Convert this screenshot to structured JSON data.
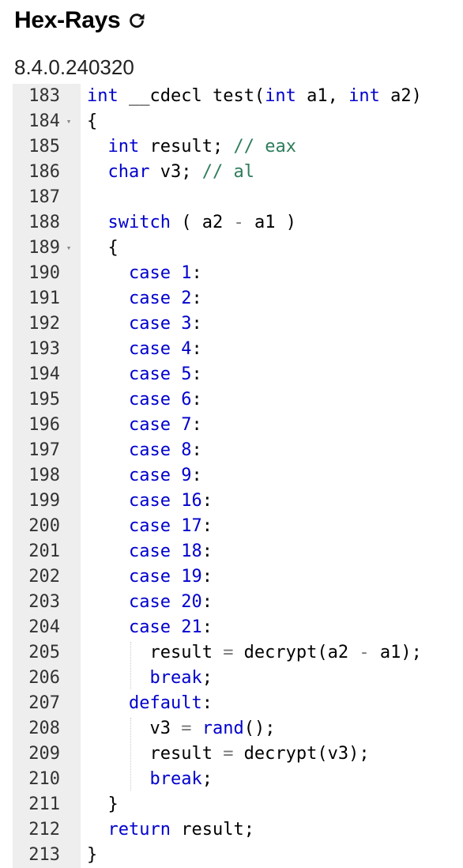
{
  "header": {
    "title": "Hex-Rays",
    "refresh_icon": "refresh-icon",
    "version": "8.4.0.240320"
  },
  "code": {
    "lines": [
      {
        "n": "183",
        "fold": false,
        "tokens": [
          {
            "t": "",
            "c": ""
          },
          {
            "t": "int",
            "c": "kw"
          },
          {
            "t": " __cdecl test(",
            "c": ""
          },
          {
            "t": "int",
            "c": "kw"
          },
          {
            "t": " a1, ",
            "c": ""
          },
          {
            "t": "int",
            "c": "kw"
          },
          {
            "t": " a2)",
            "c": ""
          }
        ]
      },
      {
        "n": "184",
        "fold": true,
        "tokens": [
          {
            "t": "{",
            "c": ""
          }
        ]
      },
      {
        "n": "185",
        "fold": false,
        "tokens": [
          {
            "t": "  ",
            "c": ""
          },
          {
            "t": "int",
            "c": "kw"
          },
          {
            "t": " result; ",
            "c": ""
          },
          {
            "t": "// eax",
            "c": "cm"
          }
        ]
      },
      {
        "n": "186",
        "fold": false,
        "tokens": [
          {
            "t": "  ",
            "c": ""
          },
          {
            "t": "char",
            "c": "kw"
          },
          {
            "t": " v3; ",
            "c": ""
          },
          {
            "t": "// al",
            "c": "cm"
          }
        ]
      },
      {
        "n": "187",
        "fold": false,
        "tokens": []
      },
      {
        "n": "188",
        "fold": false,
        "tokens": [
          {
            "t": "  ",
            "c": ""
          },
          {
            "t": "switch",
            "c": "kw"
          },
          {
            "t": " ( a2 ",
            "c": ""
          },
          {
            "t": "-",
            "c": "op"
          },
          {
            "t": " a1 )",
            "c": ""
          }
        ]
      },
      {
        "n": "189",
        "fold": true,
        "tokens": [
          {
            "t": "  {",
            "c": ""
          }
        ]
      },
      {
        "n": "190",
        "fold": false,
        "tokens": [
          {
            "t": "    ",
            "c": ""
          },
          {
            "t": "case",
            "c": "kw"
          },
          {
            "t": " ",
            "c": ""
          },
          {
            "t": "1",
            "c": "kw"
          },
          {
            "t": ":",
            "c": ""
          }
        ]
      },
      {
        "n": "191",
        "fold": false,
        "tokens": [
          {
            "t": "    ",
            "c": ""
          },
          {
            "t": "case",
            "c": "kw"
          },
          {
            "t": " ",
            "c": ""
          },
          {
            "t": "2",
            "c": "kw"
          },
          {
            "t": ":",
            "c": ""
          }
        ]
      },
      {
        "n": "192",
        "fold": false,
        "tokens": [
          {
            "t": "    ",
            "c": ""
          },
          {
            "t": "case",
            "c": "kw"
          },
          {
            "t": " ",
            "c": ""
          },
          {
            "t": "3",
            "c": "kw"
          },
          {
            "t": ":",
            "c": ""
          }
        ]
      },
      {
        "n": "193",
        "fold": false,
        "tokens": [
          {
            "t": "    ",
            "c": ""
          },
          {
            "t": "case",
            "c": "kw"
          },
          {
            "t": " ",
            "c": ""
          },
          {
            "t": "4",
            "c": "kw"
          },
          {
            "t": ":",
            "c": ""
          }
        ]
      },
      {
        "n": "194",
        "fold": false,
        "tokens": [
          {
            "t": "    ",
            "c": ""
          },
          {
            "t": "case",
            "c": "kw"
          },
          {
            "t": " ",
            "c": ""
          },
          {
            "t": "5",
            "c": "kw"
          },
          {
            "t": ":",
            "c": ""
          }
        ]
      },
      {
        "n": "195",
        "fold": false,
        "tokens": [
          {
            "t": "    ",
            "c": ""
          },
          {
            "t": "case",
            "c": "kw"
          },
          {
            "t": " ",
            "c": ""
          },
          {
            "t": "6",
            "c": "kw"
          },
          {
            "t": ":",
            "c": ""
          }
        ]
      },
      {
        "n": "196",
        "fold": false,
        "tokens": [
          {
            "t": "    ",
            "c": ""
          },
          {
            "t": "case",
            "c": "kw"
          },
          {
            "t": " ",
            "c": ""
          },
          {
            "t": "7",
            "c": "kw"
          },
          {
            "t": ":",
            "c": ""
          }
        ]
      },
      {
        "n": "197",
        "fold": false,
        "tokens": [
          {
            "t": "    ",
            "c": ""
          },
          {
            "t": "case",
            "c": "kw"
          },
          {
            "t": " ",
            "c": ""
          },
          {
            "t": "8",
            "c": "kw"
          },
          {
            "t": ":",
            "c": ""
          }
        ]
      },
      {
        "n": "198",
        "fold": false,
        "tokens": [
          {
            "t": "    ",
            "c": ""
          },
          {
            "t": "case",
            "c": "kw"
          },
          {
            "t": " ",
            "c": ""
          },
          {
            "t": "9",
            "c": "kw"
          },
          {
            "t": ":",
            "c": ""
          }
        ]
      },
      {
        "n": "199",
        "fold": false,
        "tokens": [
          {
            "t": "    ",
            "c": ""
          },
          {
            "t": "case",
            "c": "kw"
          },
          {
            "t": " ",
            "c": ""
          },
          {
            "t": "16",
            "c": "kw"
          },
          {
            "t": ":",
            "c": ""
          }
        ]
      },
      {
        "n": "200",
        "fold": false,
        "tokens": [
          {
            "t": "    ",
            "c": ""
          },
          {
            "t": "case",
            "c": "kw"
          },
          {
            "t": " ",
            "c": ""
          },
          {
            "t": "17",
            "c": "kw"
          },
          {
            "t": ":",
            "c": ""
          }
        ]
      },
      {
        "n": "201",
        "fold": false,
        "tokens": [
          {
            "t": "    ",
            "c": ""
          },
          {
            "t": "case",
            "c": "kw"
          },
          {
            "t": " ",
            "c": ""
          },
          {
            "t": "18",
            "c": "kw"
          },
          {
            "t": ":",
            "c": ""
          }
        ]
      },
      {
        "n": "202",
        "fold": false,
        "tokens": [
          {
            "t": "    ",
            "c": ""
          },
          {
            "t": "case",
            "c": "kw"
          },
          {
            "t": " ",
            "c": ""
          },
          {
            "t": "19",
            "c": "kw"
          },
          {
            "t": ":",
            "c": ""
          }
        ]
      },
      {
        "n": "203",
        "fold": false,
        "tokens": [
          {
            "t": "    ",
            "c": ""
          },
          {
            "t": "case",
            "c": "kw"
          },
          {
            "t": " ",
            "c": ""
          },
          {
            "t": "20",
            "c": "kw"
          },
          {
            "t": ":",
            "c": ""
          }
        ]
      },
      {
        "n": "204",
        "fold": false,
        "tokens": [
          {
            "t": "    ",
            "c": ""
          },
          {
            "t": "case",
            "c": "kw"
          },
          {
            "t": " ",
            "c": ""
          },
          {
            "t": "21",
            "c": "kw"
          },
          {
            "t": ":",
            "c": ""
          }
        ]
      },
      {
        "n": "205",
        "fold": false,
        "tokens": [
          {
            "t": "      result ",
            "c": ""
          },
          {
            "t": "=",
            "c": "op"
          },
          {
            "t": " decrypt(a2 ",
            "c": ""
          },
          {
            "t": "-",
            "c": "op"
          },
          {
            "t": " a1);",
            "c": ""
          }
        ]
      },
      {
        "n": "206",
        "fold": false,
        "tokens": [
          {
            "t": "      ",
            "c": ""
          },
          {
            "t": "break",
            "c": "kw"
          },
          {
            "t": ";",
            "c": ""
          }
        ]
      },
      {
        "n": "207",
        "fold": false,
        "tokens": [
          {
            "t": "    ",
            "c": ""
          },
          {
            "t": "default",
            "c": "kw"
          },
          {
            "t": ":",
            "c": ""
          }
        ]
      },
      {
        "n": "208",
        "fold": false,
        "tokens": [
          {
            "t": "      v3 ",
            "c": ""
          },
          {
            "t": "=",
            "c": "op"
          },
          {
            "t": " ",
            "c": ""
          },
          {
            "t": "rand",
            "c": "kw"
          },
          {
            "t": "();",
            "c": ""
          }
        ]
      },
      {
        "n": "209",
        "fold": false,
        "tokens": [
          {
            "t": "      result ",
            "c": ""
          },
          {
            "t": "=",
            "c": "op"
          },
          {
            "t": " decrypt(v3);",
            "c": ""
          }
        ]
      },
      {
        "n": "210",
        "fold": false,
        "tokens": [
          {
            "t": "      ",
            "c": ""
          },
          {
            "t": "break",
            "c": "kw"
          },
          {
            "t": ";",
            "c": ""
          }
        ]
      },
      {
        "n": "211",
        "fold": false,
        "tokens": [
          {
            "t": "  }",
            "c": ""
          }
        ]
      },
      {
        "n": "212",
        "fold": false,
        "tokens": [
          {
            "t": "  ",
            "c": ""
          },
          {
            "t": "return",
            "c": "kw"
          },
          {
            "t": " result;",
            "c": ""
          }
        ]
      },
      {
        "n": "213",
        "fold": false,
        "tokens": [
          {
            "t": "}",
            "c": ""
          }
        ]
      }
    ]
  }
}
